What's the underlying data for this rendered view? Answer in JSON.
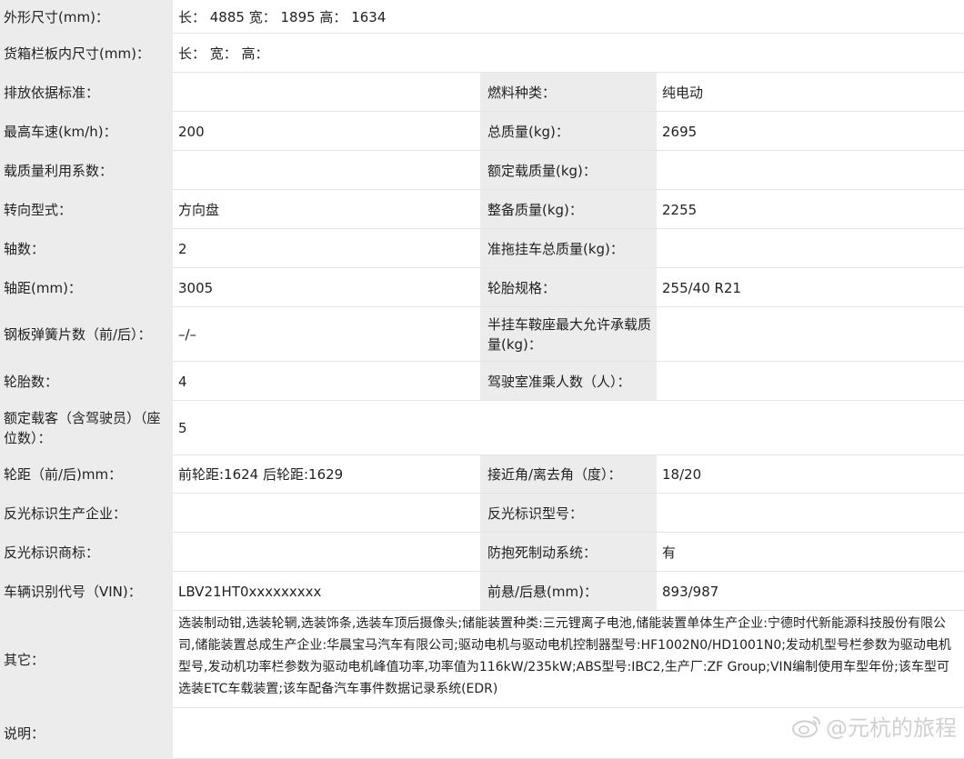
{
  "rows": [
    {
      "l": "外形尺寸(mm)：",
      "v": "长： 4885 宽： 1895 高： 1634",
      "wide": true
    },
    {
      "l": "货箱栏板内尺寸(mm)：",
      "v": "长：  宽：  高：",
      "wide": true
    },
    {
      "l": "排放依据标准：",
      "v": "",
      "l2": "燃料种类：",
      "v2": "纯电动"
    },
    {
      "l": "最高车速(km/h)：",
      "v": "200",
      "l2": "总质量(kg)：",
      "v2": "2695"
    },
    {
      "l": "载质量利用系数：",
      "v": "",
      "l2": "额定载质量(kg)：",
      "v2": ""
    },
    {
      "l": "转向型式：",
      "v": "方向盘",
      "l2": "整备质量(kg)：",
      "v2": "2255"
    },
    {
      "l": "轴数：",
      "v": "2",
      "l2": "准拖挂车总质量(kg)：",
      "v2": ""
    },
    {
      "l": "轴距(mm)：",
      "v": "3005",
      "l2": "轮胎规格：",
      "v2": "255/40 R21"
    },
    {
      "l": "钢板弹簧片数（前/后）：",
      "v": "–/–",
      "l2": "半挂车鞍座最大允许承载质量(kg)：",
      "v2": ""
    },
    {
      "l": "轮胎数：",
      "v": "4",
      "l2": "驾驶室准乘人数（人）：",
      "v2": ""
    },
    {
      "l": "额定载客（含驾驶员）（座位数）：",
      "v": "5",
      "wide": true
    },
    {
      "l": "轮距（前/后)mm：",
      "v": "前轮距:1624 后轮距:1629",
      "l2": "接近角/离去角（度）：",
      "v2": "18/20"
    },
    {
      "l": "反光标识生产企业：",
      "v": "",
      "l2": "反光标识型号：",
      "v2": ""
    },
    {
      "l": "反光标识商标：",
      "v": "",
      "l2": "防抱死制动系统：",
      "v2": "有"
    },
    {
      "l": "车辆识别代号（VIN)：",
      "v": "LBV21HT0xxxxxxxxx",
      "l2": "前悬/后悬(mm)：",
      "v2": "893/987"
    },
    {
      "l": "其它：",
      "v": "选装制动钳,选装轮辋,选装饰条,选装车顶后摄像头;储能装置种类:三元锂离子电池,储能装置单体生产企业:宁德时代新能源科技股份有限公司,储能装置总成生产企业:华晨宝马汽车有限公司;驱动电机与驱动电机控制器型号:HF1002N0/HD1001N0;发动机型号栏参数为驱动电机型号,发动机功率栏参数为驱动电机峰值功率,功率值为116kW/235kW;ABS型号:IBC2,生产厂:ZF Group;VIN编制使用车型年份;该车型可选装ETC车载装置;该车配备汽车事件数据记录系统(EDR)",
      "note": true
    },
    {
      "l": "说明：",
      "v": "",
      "wide": true
    }
  ],
  "watermark": {
    "text": "@元杭的旅程",
    "icon": "weibo-icon"
  }
}
